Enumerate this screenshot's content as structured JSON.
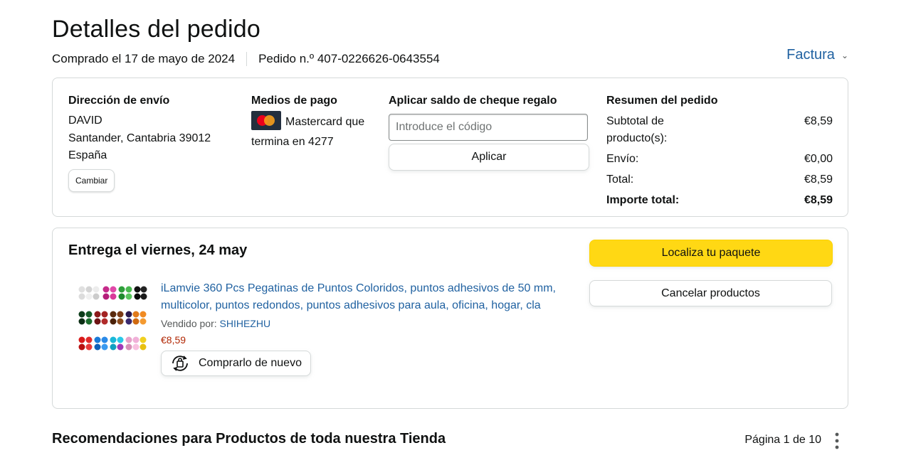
{
  "page": {
    "title": "Detalles del pedido",
    "ordered_date": "Comprado el 17 de mayo de 2024",
    "order_number": "Pedido n.º 407-0226626-0643554",
    "invoice_label": "Factura"
  },
  "shipping": {
    "heading": "Dirección de envío",
    "name": "DAVID",
    "city_line": "Santander, Cantabria 39012",
    "country": "España",
    "change_label": "Cambiar"
  },
  "payment": {
    "heading": "Medios de pago",
    "card_text_1": "Mastercard que",
    "card_text_2": "termina en 4277",
    "card_icon": "mastercard-icon"
  },
  "gift": {
    "heading": "Aplicar saldo de cheque regalo",
    "placeholder": "Introduce el código",
    "value": "",
    "apply_label": "Aplicar"
  },
  "summary": {
    "heading": "Resumen del pedido",
    "rows": [
      {
        "label": "Subtotal de producto(s):",
        "value": "€8,59"
      },
      {
        "label": "Envío:",
        "value": "€0,00"
      },
      {
        "label": "Total:",
        "value": "€8,59"
      },
      {
        "label": "Importe total:",
        "value": "€8,59"
      }
    ]
  },
  "delivery": {
    "title": "Entrega el viernes, 24 may",
    "track_label": "Localiza tu paquete",
    "cancel_label": "Cancelar productos",
    "product": {
      "title": "iLamvie 360 Pcs Pegatinas de Puntos Coloridos, puntos adhesivos de 50 mm, multicolor, puntos redondos, puntos adhesivos para aula, oficina, hogar, cla",
      "sold_by_label": "Vendido por:",
      "seller": "SHIHEZHU",
      "price": "€8,59",
      "buy_again_label": "Comprarlo de nuevo"
    }
  },
  "recommendations": {
    "title": "Recomendaciones para Productos de toda nuestra Tienda",
    "pager": "Página 1 de 10"
  },
  "colors": {
    "link": "#2162a1",
    "price": "#b12704",
    "primary_button": "#ffd814",
    "border": "#d5d9d9"
  }
}
